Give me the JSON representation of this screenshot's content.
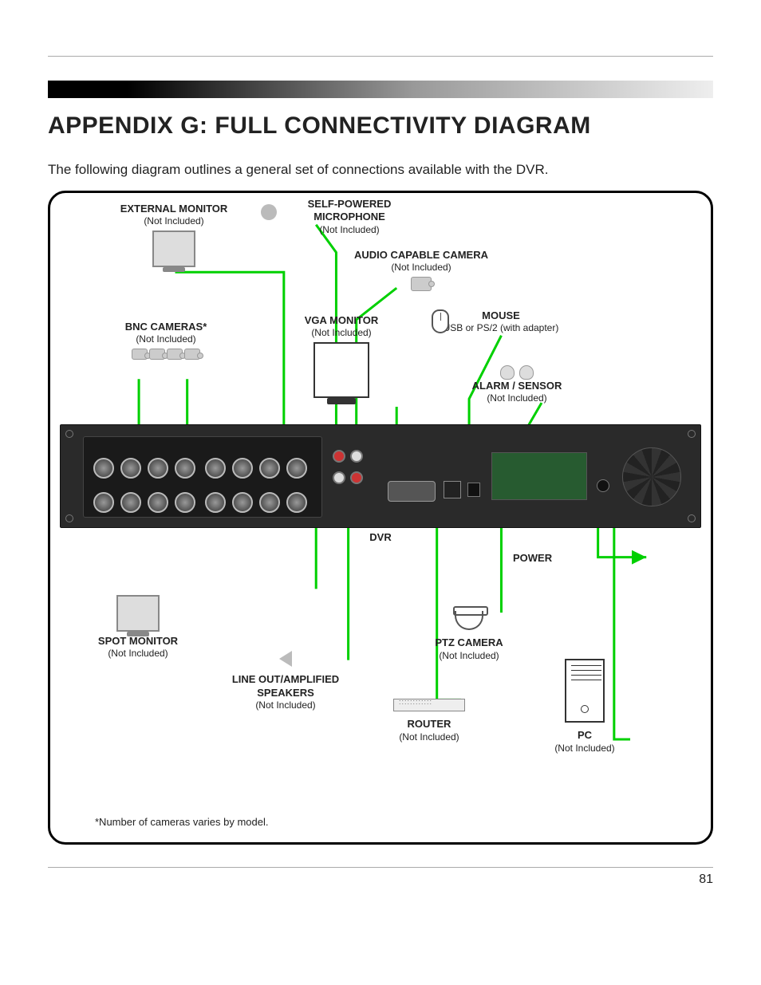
{
  "page": {
    "title": "APPENDIX G: FULL CONNECTIVITY DIAGRAM",
    "intro": "The following diagram outlines a general set of connections available with the DVR.",
    "number": "81"
  },
  "nodes": {
    "external_monitor": {
      "title": "EXTERNAL MONITOR",
      "sub": "(Not Included)"
    },
    "microphone": {
      "title": "SELF-POWERED MICROPHONE",
      "sub": "(Not Included)"
    },
    "audio_camera": {
      "title": "AUDIO CAPABLE CAMERA",
      "sub": "(Not Included)"
    },
    "bnc_cameras": {
      "title": "BNC CAMERAS*",
      "sub": "(Not Included)"
    },
    "vga_monitor": {
      "title": "VGA MONITOR",
      "sub": "(Not Included)"
    },
    "mouse": {
      "title": "MOUSE",
      "sub": "USB or PS/2 (with adapter)"
    },
    "alarm": {
      "title": "ALARM / SENSOR",
      "sub": "(Not Included)"
    },
    "spot_monitor": {
      "title": "SPOT MONITOR",
      "sub": "(Not Included)"
    },
    "speakers": {
      "title": "LINE OUT/AMPLIFIED SPEAKERS",
      "sub": "(Not Included)"
    },
    "ptz": {
      "title": "PTZ CAMERA",
      "sub": "(Not Included)"
    },
    "router": {
      "title": "ROUTER",
      "sub": "(Not Included)"
    },
    "pc": {
      "title": "PC",
      "sub": "(Not Included)"
    },
    "power": {
      "title": "POWER"
    },
    "dvr": {
      "title": "DVR"
    }
  },
  "footnote": "*Number of cameras varies by model.",
  "colors": {
    "connector": "#00d000"
  }
}
